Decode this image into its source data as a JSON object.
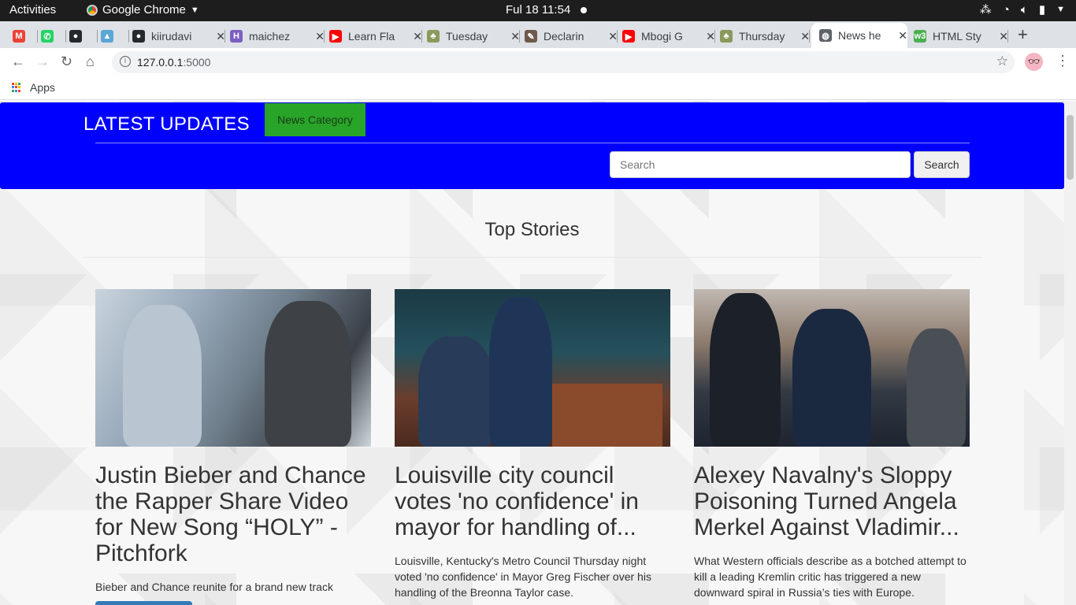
{
  "system_bar": {
    "activities": "Activities",
    "app_name": "Google Chrome",
    "clock": "Ful 18  11:54"
  },
  "browser": {
    "tabs": [
      {
        "label": "",
        "icon": "gmail-icon",
        "color": "#ea4335",
        "glyph": "M"
      },
      {
        "label": "",
        "icon": "whatsapp-icon",
        "color": "#25d366",
        "glyph": "✆"
      },
      {
        "label": "",
        "icon": "github-icon",
        "color": "#24292e",
        "glyph": "●"
      },
      {
        "label": "",
        "icon": "app-icon",
        "color": "#5aa7d6",
        "glyph": "▲"
      },
      {
        "label": "kiirudavi",
        "icon": "github-icon",
        "color": "#24292e",
        "glyph": "●"
      },
      {
        "label": "maichez",
        "icon": "heroku-icon",
        "color": "#7b5fc2",
        "glyph": "H"
      },
      {
        "label": "Learn Fla",
        "icon": "youtube-icon",
        "color": "#ff0000",
        "glyph": "▶"
      },
      {
        "label": "Tuesday",
        "icon": "tree-icon",
        "color": "#8a9a5b",
        "glyph": "♣"
      },
      {
        "label": "Declarin",
        "icon": "document-icon",
        "color": "#6d5a4a",
        "glyph": "✎"
      },
      {
        "label": "Mbogi G",
        "icon": "youtube-icon",
        "color": "#ff0000",
        "glyph": "▶"
      },
      {
        "label": "Thursday",
        "icon": "tree-icon",
        "color": "#8a9a5b",
        "glyph": "♣"
      },
      {
        "label": "News he",
        "icon": "globe-icon",
        "color": "#5f6368",
        "glyph": "◍",
        "active": true
      },
      {
        "label": "HTML Sty",
        "icon": "w3schools-icon",
        "color": "#4caf50",
        "glyph": "w3"
      }
    ],
    "address": {
      "host": "127.0.0.1",
      "port": ":5000"
    },
    "bookmarks": {
      "apps_label": "Apps"
    }
  },
  "page": {
    "brand": "LATEST UPDATES",
    "category_button": "News Category",
    "search": {
      "placeholder": "Search",
      "button": "Search"
    },
    "section_title": "Top Stories",
    "articles": [
      {
        "title": "Justin Bieber and Chance the Rapper Share Video for New Song “HOLY” - Pitchfork",
        "description": "Bieber and Chance reunite for a brand new track"
      },
      {
        "title": "Louisville city council votes 'no confidence' in mayor for handling of...",
        "description": "Louisville, Kentucky's Metro Council Thursday night voted 'no confidence' in Mayor Greg Fischer over his handling of the Breonna Taylor case."
      },
      {
        "title": "Alexey Navalny's Sloppy Poisoning Turned Angela Merkel Against Vladimir...",
        "description": "What Western officials describe as a botched attempt to kill a leading Kremlin critic has triggered a new downward spiral in Russia’s ties with Europe."
      }
    ]
  },
  "colors": {
    "navbar": "#0000ff",
    "category_button": "#28a428",
    "read_more": "#337ab7"
  }
}
